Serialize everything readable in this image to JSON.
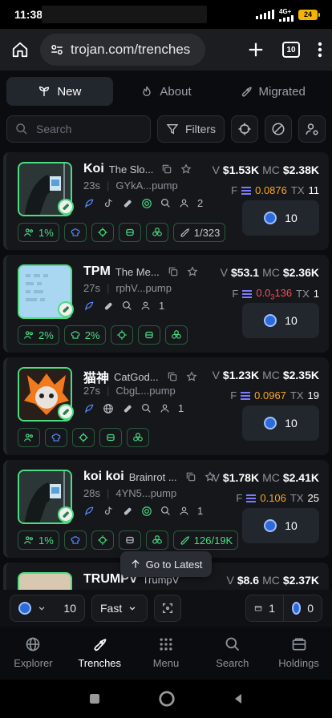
{
  "status_bar": {
    "time": "11:38",
    "network": "4G+",
    "battery": "24"
  },
  "browser": {
    "url": "trojan.com/trenches",
    "tab_count": "10"
  },
  "tabs": [
    {
      "label": "New",
      "icon": "sprout-icon",
      "active": true
    },
    {
      "label": "About",
      "icon": "flame-icon",
      "active": false
    },
    {
      "label": "Migrated",
      "icon": "rocket-icon",
      "active": false
    }
  ],
  "filters": {
    "search_placeholder": "Search",
    "filters_label": "Filters"
  },
  "colors": {
    "accent_green": "#4ade80",
    "fee_orange": "#f5a623",
    "fee_red": "#f0515a",
    "sol_blue": "#2e6bd8"
  },
  "tokens": [
    {
      "symbol": "Koi",
      "name": "The Slo...",
      "age": "23s",
      "address": "GYkA...pump",
      "holders": "2",
      "volume": "$1.53K",
      "mcap": "$2.38K",
      "fee": "0.0876",
      "tx": "11",
      "buy_amount": "10",
      "chips": [
        "1%",
        "",
        "",
        "",
        "",
        "1/323"
      ]
    },
    {
      "symbol": "TPM",
      "name": "The Me...",
      "age": "27s",
      "address": "rphV...pump",
      "holders": "1",
      "volume": "$53.1",
      "mcap": "$2.36K",
      "fee_prefix": "0.0",
      "fee_sub": "3",
      "fee_suffix": "136",
      "tx": "1",
      "buy_amount": "10",
      "chips": [
        "2%",
        "2%",
        "",
        "",
        ""
      ]
    },
    {
      "symbol": "猫神",
      "name": "CatGod...",
      "age": "27s",
      "address": "CbgL...pump",
      "holders": "1",
      "volume": "$1.23K",
      "mcap": "$2.35K",
      "fee": "0.0967",
      "tx": "19",
      "buy_amount": "10",
      "chips": [
        "",
        "",
        "",
        "",
        ""
      ]
    },
    {
      "symbol": "koi koi",
      "name": "Brainrot ...",
      "age": "28s",
      "address": "4YN5...pump",
      "holders": "1",
      "volume": "$1.78K",
      "mcap": "$2.41K",
      "fee": "0.106",
      "tx": "25",
      "buy_amount": "10",
      "chips": [
        "1%",
        "",
        "",
        "",
        "",
        "126/19K"
      ]
    },
    {
      "symbol": "TRUMPV",
      "name": "TrumpV",
      "volume": "$8.6",
      "mcap": "$2.37K"
    }
  ],
  "labels": {
    "v": "V",
    "mc": "MC",
    "f": "F",
    "tx": "TX"
  },
  "go_to_latest": "Go to Latest",
  "quickbar": {
    "amount": "10",
    "speed": "Fast",
    "wallets": "1",
    "balance": "0"
  },
  "nav": [
    {
      "label": "Explorer",
      "icon": "globe-icon"
    },
    {
      "label": "Trenches",
      "icon": "rocket-icon",
      "active": true
    },
    {
      "label": "Menu",
      "icon": "grid-icon"
    },
    {
      "label": "Search",
      "icon": "search-icon"
    },
    {
      "label": "Holdings",
      "icon": "wallet-icon"
    }
  ]
}
